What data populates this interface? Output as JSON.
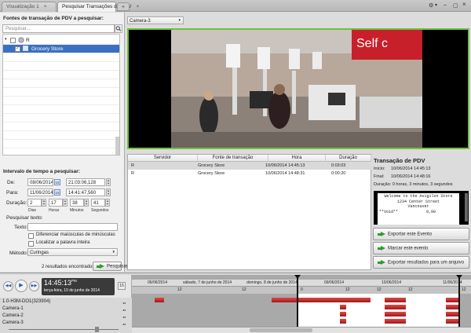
{
  "tabs": [
    {
      "label": "Visualização 1",
      "close": "×"
    },
    {
      "label": "Pesquisar Transações de PDV",
      "close": "×"
    }
  ],
  "tab_add": "+",
  "window_controls": {
    "gear": "⚙",
    "chevron": "▾",
    "minimize": "–",
    "maximize": "▢",
    "close": "×"
  },
  "left": {
    "sources_title": "Fontes de transação de PDV a pesquisar:",
    "search_placeholder": "Pesquisar...",
    "tree": {
      "root_label": "R",
      "child_label": "Grocery Store"
    },
    "interval_title": "Intervalo de tempo a pesquisar:",
    "from_label": "De:",
    "from_date": "08/06/2014",
    "from_time": "21:03:06,128",
    "to_label": "Para:",
    "to_date": "11/06/2014",
    "to_time": "14:41:47,560",
    "duration_label": "Duração:",
    "duration": {
      "days": "2",
      "hours": "17",
      "minutes": "38",
      "seconds": "41"
    },
    "duration_units": {
      "days": "Dias",
      "hours": "Horas",
      "minutes": "Minutos",
      "seconds": "Segundos"
    },
    "search_text_title": "Pesquisar texto:",
    "text_label": "Texto:",
    "case_sensitive": "Diferenciar maiúsculas de minúsculas",
    "whole_word": "Localizar a palavra inteira",
    "method_label": "Método:",
    "method_value": "Curingas",
    "results_count": "2 resultados encontrados",
    "search_button": "Pesquisar"
  },
  "camera_select": "Camera-3",
  "table": {
    "headers": [
      "Servidor",
      "Fonte de transação",
      "Hora",
      "Duração"
    ],
    "rows": [
      [
        "R",
        "Grocery Store",
        "10/06/2014 14:45:13",
        "0:03:03"
      ],
      [
        "R",
        "Grocery Store",
        "10/06/2014 14:48:31",
        "0:00:20"
      ]
    ]
  },
  "detail": {
    "title": "Transação de PDV",
    "start_label": "Início:",
    "start_value": "10/06/2014 14:45:13",
    "end_label": "Final:",
    "end_value": "10/06/2014 14:48:16",
    "duration_text": "Duração: 0 horas, 3 minutos, 3 segundos",
    "receipt": [
      "Welcome to the Avigilon Store",
      "1234 Center Street",
      "Vancouver",
      "**Void**",
      "0,00"
    ],
    "export_button": "Exportar este Evento",
    "mark_button": "Marcar este evento",
    "export_results_button": "Exportar resultados para um arquivo"
  },
  "video": {
    "store_sign": "Self c"
  },
  "timeline": {
    "clock": "14:45:13",
    "clock_ampm": "PM",
    "date": "terça-feira, 10 de junho de 2014",
    "day_labels": [
      "06/06/2014",
      "sábado, 7 de junho de 2014",
      "domingo, 8 de junho de 2014",
      "09/06/2014",
      "10/06/2014",
      "11/06/2014"
    ],
    "hour_labels": [
      "12",
      "12",
      "12",
      "12",
      "12",
      "12",
      "0"
    ],
    "cameras": [
      "1.0-H3M-DO1(323904)",
      "Camera-1",
      "Camera-2",
      "Camera-3"
    ]
  },
  "colors": {
    "accent_green": "#6fbf3e",
    "selection_blue": "#3b6fc1",
    "recording_red": "#c02a2a"
  }
}
